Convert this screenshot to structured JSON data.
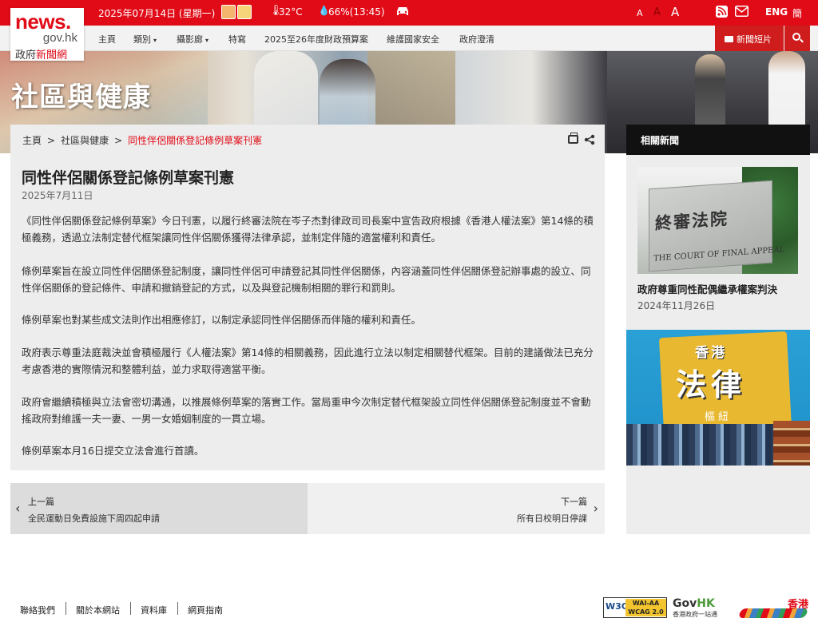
{
  "topbar": {
    "date": "2025年07月14日 (星期一)",
    "temperature": "32°C",
    "humidity": "66%(13:45)",
    "font_sizes": [
      "A",
      "A",
      "A"
    ],
    "lang_en": "ENG",
    "lang_sc": "簡",
    "icons": [
      "weather-sunny-icon",
      "weather-warning-icon",
      "thermometer-icon",
      "humidity-drop-icon",
      "traffic-car-icon",
      "rss-icon",
      "mail-icon"
    ]
  },
  "logo": {
    "line1": "news.",
    "line2": "gov.hk",
    "line3_prefix": "政府",
    "line3_accent": "新聞網"
  },
  "nav": {
    "items": [
      "主頁",
      "類別",
      "攝影廊",
      "特寫",
      "2025至26年度財政預算案",
      "維護國家安全",
      "政府澄清"
    ],
    "caret": "▾",
    "newsclip_label": "新聞短片"
  },
  "hero": {
    "section_title": "社區與健康"
  },
  "breadcrumb": {
    "home": "主頁",
    "sep": ">",
    "section": "社區與健康",
    "current": "同性伴侶關係登記條例草案刊憲"
  },
  "article": {
    "title": "同性伴侶關係登記條例草案刊憲",
    "date": "2025年7月11日",
    "paragraphs": [
      "《同性伴侶關係登記條例草案》今日刊憲，以履行終審法院在岑子杰對律政司司長案中宣告政府根據《香港人權法案》第14條的積極義務，透過立法制定替代框架讓同性伴侶關係獲得法律承認，並制定伴隨的適當權利和責任。",
      "條例草案旨在設立同性伴侶關係登記制度，讓同性伴侶可申請登記其同性伴侶關係，內容涵蓋同性伴侶關係登記辦事處的設立、同性伴侶關係的登記條件、申請和撤銷登記的方式，以及與登記機制相關的罪行和罰則。",
      "條例草案也對某些成文法則作出相應修訂，以制定承認同性伴侶關係而伴隨的權利和責任。",
      "政府表示尊重法庭裁決並會積極履行《人權法案》第14條的相關義務，因此進行立法以制定相關替代框架。目前的建議做法已充分考慮香港的實際情況和整體利益，並力求取得適當平衡。",
      "政府會繼續積極與立法會密切溝通，以推展條例草案的落實工作。當局重申今次制定替代框架設立同性伴侶關係登記制度並不會動搖政府對維護一夫一妻、一男一女婚姻制度的一貫立場。",
      "條例草案本月16日提交立法會進行首讀。"
    ]
  },
  "pager": {
    "prev_label": "上一篇",
    "prev_title": "全民運動日免費設施下周四起申請",
    "next_label": "下一篇",
    "next_title": "所有日校明日停課",
    "prev_chevron": "‹",
    "next_chevron": "›"
  },
  "sidebar": {
    "heading": "相關新聞",
    "items": [
      {
        "image_text_zh": "終審法院",
        "image_text_en": "THE COURT OF FINAL APPEAL",
        "title": "政府尊重同性配偶繼承權案判決",
        "date": "2024年11月26日"
      },
      {
        "image_text_top": "香港",
        "image_text_main": "法律",
        "image_text_bottom": "樞紐"
      }
    ]
  },
  "footer": {
    "links": [
      "聯絡我們",
      "關於本網站",
      "資料庫",
      "網頁指南"
    ],
    "w3c": "W3C",
    "wcag_line1": "WAI-AA",
    "wcag_line2": "WCAG 2.0",
    "govhk_main": "Gov",
    "govhk_accent": "HK",
    "govhk_sub": "香港政府一站通",
    "brandhk": "香港"
  },
  "colors": {
    "brand_red": "#e10b17",
    "dark_red": "#cf1d1d",
    "panel_grey": "#ededed",
    "sidebar_head": "#111111"
  }
}
